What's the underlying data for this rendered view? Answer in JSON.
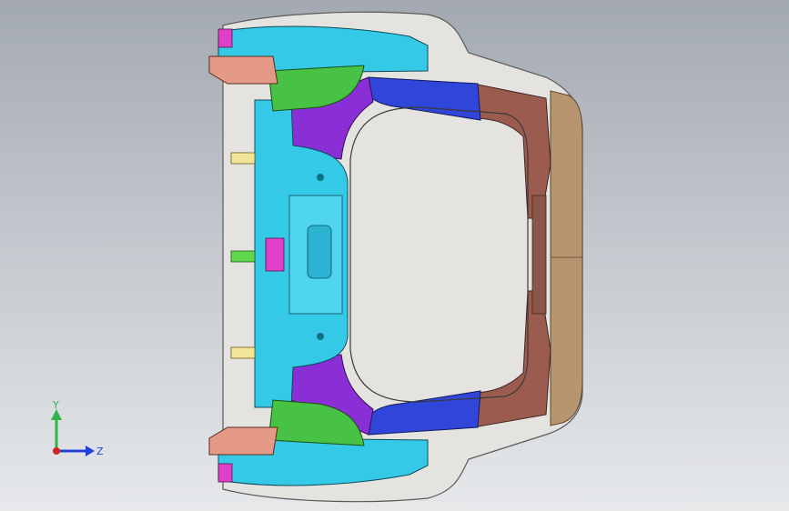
{
  "viewport": {
    "background_top": "#a3a9b0",
    "background_bottom": "#e6e8ea"
  },
  "model": {
    "part_colors": {
      "outer_shell": "#e4e3df",
      "rear_panel": "#b7956f",
      "rear_inner": "#9b5c4f",
      "crossmember_cyan": "#35c9e8",
      "side_rail_blue": "#2f46d8",
      "corner_purple": "#8a2fd6",
      "bracket_magenta": "#e040c8",
      "gusset_green": "#47c244",
      "mount_salmon": "#e49a86",
      "mount_yellow": "#f1e59a"
    }
  },
  "triad": {
    "y_label": "Y",
    "z_label": "Z",
    "y_color": "#2fb34a",
    "z_color": "#2341d6",
    "x_color": "#d32222"
  }
}
